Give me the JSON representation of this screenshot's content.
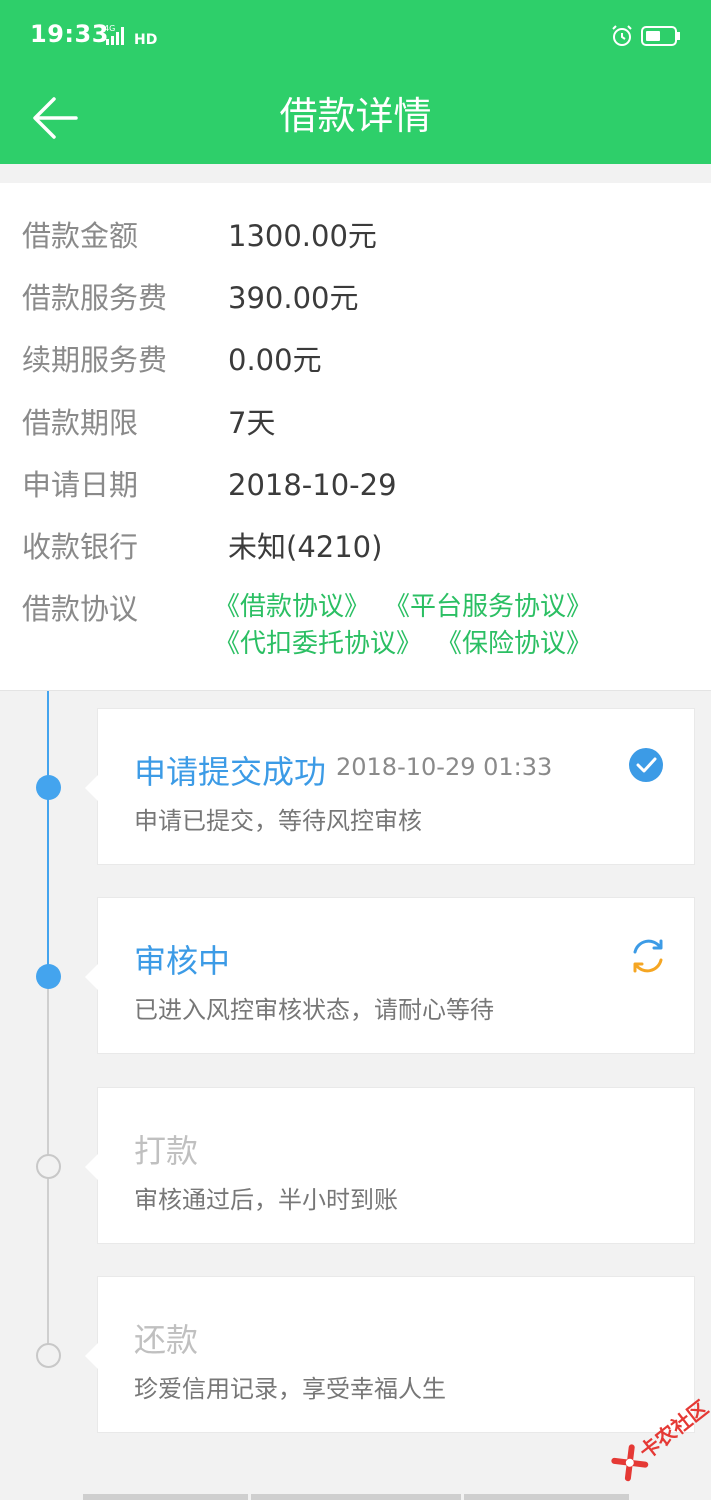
{
  "status_bar": {
    "time": "19:33",
    "network": "4G",
    "hd": "HD",
    "icons": [
      "signal-icon",
      "hd-icon",
      "alarm-icon",
      "battery-icon"
    ]
  },
  "app_bar": {
    "title": "借款详情",
    "back_icon": "arrow-left-icon"
  },
  "details": [
    {
      "label": "借款金额",
      "value": "1300.00元"
    },
    {
      "label": "借款服务费",
      "value": "390.00元"
    },
    {
      "label": "续期服务费",
      "value": "0.00元"
    },
    {
      "label": "借款期限",
      "value": "7天"
    },
    {
      "label": "申请日期",
      "value": "2018-10-29"
    },
    {
      "label": "收款银行",
      "value": "未知(4210)"
    }
  ],
  "agreements": {
    "label": "借款协议",
    "links": [
      "《借款协议》",
      "《平台服务协议》",
      "《代扣委托协议》",
      "《保险协议》"
    ]
  },
  "timeline": [
    {
      "title": "申请提交成功",
      "time": "2018-10-29 01:33",
      "desc": "申请已提交，等待风控审核",
      "state": "done",
      "icon": "check-circle-icon"
    },
    {
      "title": "审核中",
      "desc": "已进入风控审核状态，请耐心等待",
      "state": "active",
      "icon": "refresh-icon"
    },
    {
      "title": "打款",
      "desc": "审核通过后，半小时到账",
      "state": "pending"
    },
    {
      "title": "还款",
      "desc": "珍爱信用记录，享受幸福人生",
      "state": "pending"
    }
  ],
  "colors": {
    "brand_green": "#2ecf6a",
    "link_green": "#2bbf63",
    "timeline_blue": "#44a4ee",
    "pending_grey": "#c0c0c0",
    "refresh_orange": "#f5a623"
  },
  "watermark": {
    "text": "卡农社区"
  }
}
